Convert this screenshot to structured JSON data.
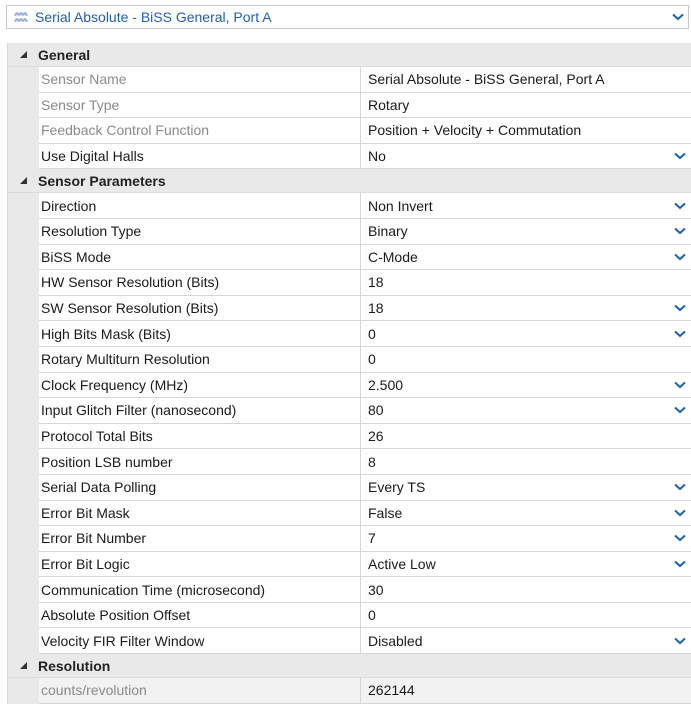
{
  "header": {
    "title": "Serial Absolute - BiSS General, Port A",
    "icon": "serial-sensor-icon",
    "accent": "#1f5fb0"
  },
  "groups": [
    {
      "label": "General",
      "rows": [
        {
          "name": "Sensor Name",
          "value": "Serial Absolute - BiSS General, Port A",
          "readonly": true,
          "dropdown": false
        },
        {
          "name": "Sensor Type",
          "value": "Rotary",
          "readonly": true,
          "dropdown": false
        },
        {
          "name": "Feedback Control Function",
          "value": "Position + Velocity + Commutation",
          "readonly": true,
          "dropdown": false
        },
        {
          "name": "Use Digital Halls",
          "value": "No",
          "readonly": false,
          "dropdown": true
        }
      ]
    },
    {
      "label": "Sensor Parameters",
      "rows": [
        {
          "name": "Direction",
          "value": "Non Invert",
          "readonly": false,
          "dropdown": true
        },
        {
          "name": "Resolution Type",
          "value": "Binary",
          "readonly": false,
          "dropdown": true
        },
        {
          "name": "BiSS Mode",
          "value": "C-Mode",
          "readonly": false,
          "dropdown": true
        },
        {
          "name": "HW Sensor Resolution (Bits)",
          "value": "18",
          "readonly": false,
          "dropdown": false
        },
        {
          "name": "SW Sensor Resolution (Bits)",
          "value": "18",
          "readonly": false,
          "dropdown": true
        },
        {
          "name": "High Bits Mask (Bits)",
          "value": "0",
          "readonly": false,
          "dropdown": true
        },
        {
          "name": "Rotary Multiturn Resolution",
          "value": "0",
          "readonly": false,
          "dropdown": false
        },
        {
          "name": "Clock Frequency (MHz)",
          "value": "2.500",
          "readonly": false,
          "dropdown": true
        },
        {
          "name": "Input Glitch Filter (nanosecond)",
          "value": "80",
          "readonly": false,
          "dropdown": true
        },
        {
          "name": "Protocol Total Bits",
          "value": "26",
          "readonly": false,
          "dropdown": false
        },
        {
          "name": "Position LSB number",
          "value": "8",
          "readonly": false,
          "dropdown": false
        },
        {
          "name": "Serial Data Polling",
          "value": "Every TS",
          "readonly": false,
          "dropdown": true
        },
        {
          "name": "Error Bit Mask",
          "value": "False",
          "readonly": false,
          "dropdown": true
        },
        {
          "name": "Error Bit Number",
          "value": "7",
          "readonly": false,
          "dropdown": true
        },
        {
          "name": "Error Bit Logic",
          "value": "Active Low",
          "readonly": false,
          "dropdown": true
        },
        {
          "name": "Communication Time (microsecond)",
          "value": "30",
          "readonly": false,
          "dropdown": false
        },
        {
          "name": "Absolute Position Offset",
          "value": "0",
          "readonly": false,
          "dropdown": false
        },
        {
          "name": "Velocity FIR Filter Window",
          "value": "Disabled",
          "readonly": false,
          "dropdown": true
        }
      ]
    },
    {
      "label": "Resolution",
      "rows": [
        {
          "name": "counts/revolution",
          "value": "262144",
          "readonly": true,
          "dropdown": false,
          "shaded": true
        }
      ]
    }
  ]
}
